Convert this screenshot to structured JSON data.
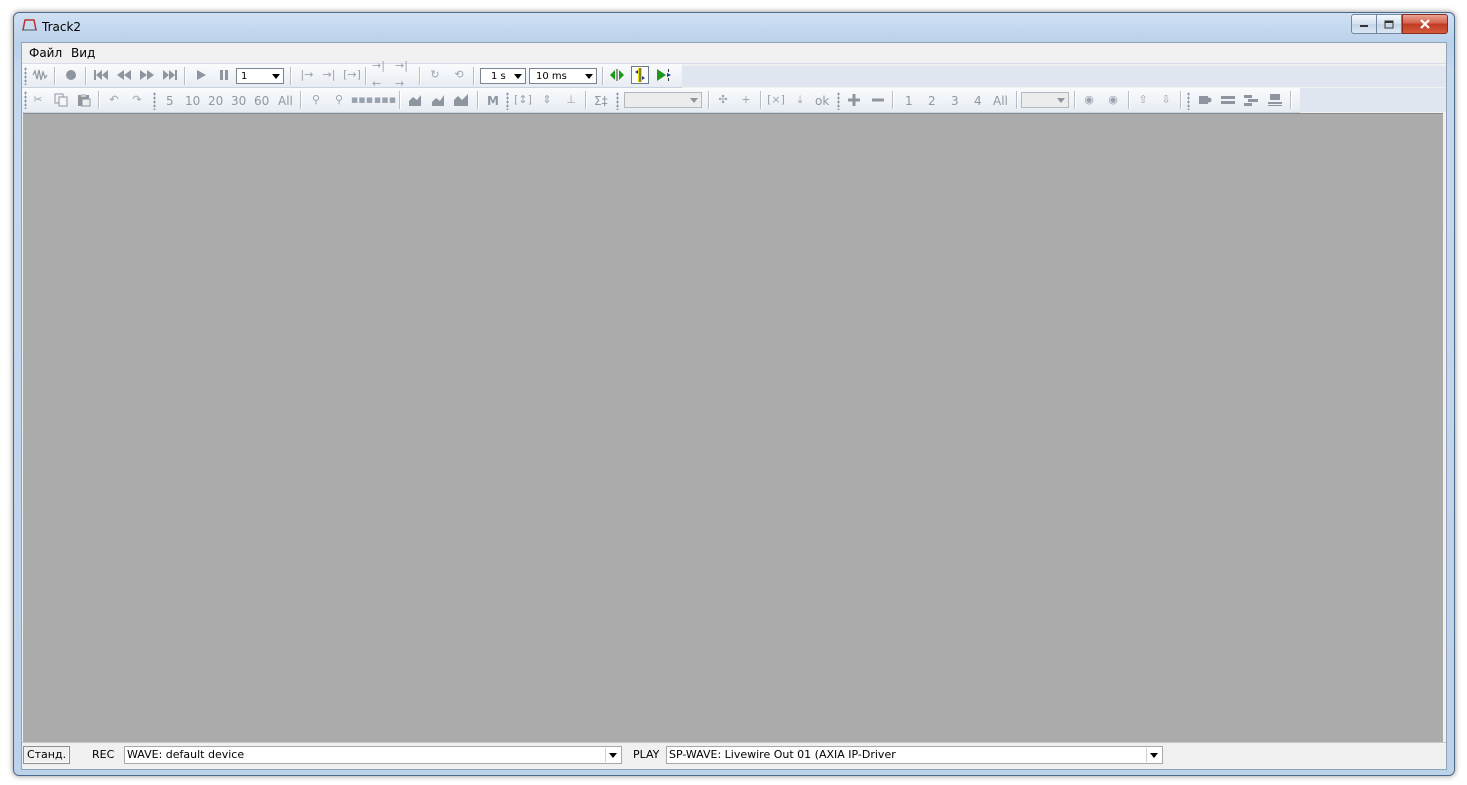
{
  "window": {
    "title": "Track2"
  },
  "menu": {
    "items": [
      "Файл",
      "Вид"
    ]
  },
  "toolbar1": {
    "count_value": "1",
    "interval_value": "1 s",
    "resolution_value": "10 ms"
  },
  "toolbar2": {
    "zoom_levels": [
      "5",
      "10",
      "20",
      "30",
      "60",
      "All"
    ],
    "m_label": "M",
    "sigma_label": "Σ‡",
    "ok_label": "ok",
    "channels": [
      "1",
      "2",
      "3",
      "4",
      "All"
    ]
  },
  "statusbar": {
    "mode_label": "Станд.",
    "rec_label": "REC",
    "rec_device": "WAVE: default device",
    "play_label": "PLAY",
    "play_device": "SP-WAVE: Livewire Out 01 (AXIA IP-Driver"
  },
  "colors": {
    "canvas": "#ababab",
    "accent_green": "#1a9a1a",
    "accent_yellow": "#f0e000",
    "close_button": "#c13b24"
  }
}
